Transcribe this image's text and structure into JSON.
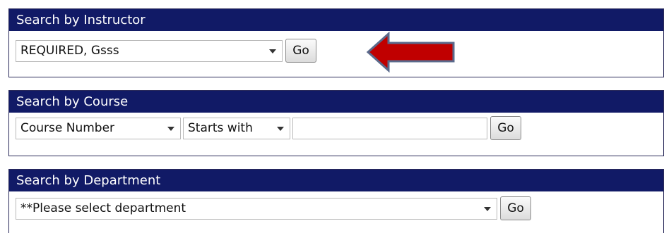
{
  "instructor_search": {
    "title": "Search by Instructor",
    "selected_instructor": "REQUIRED, Gsss",
    "go_label": "Go"
  },
  "course_search": {
    "title": "Search by Course",
    "field_selected": "Course Number",
    "match_selected": "Starts with",
    "query_value": "",
    "go_label": "Go"
  },
  "department_search": {
    "title": "Search by Department",
    "selected_department": "**Please select department",
    "go_label": "Go"
  },
  "annotation": {
    "arrow_color": "#c00000",
    "arrow_outline_color": "#5a6a8c",
    "arrow_icon": "left-arrow-icon"
  },
  "colors": {
    "header_bg": "#111a66",
    "header_text": "#ffffff"
  }
}
